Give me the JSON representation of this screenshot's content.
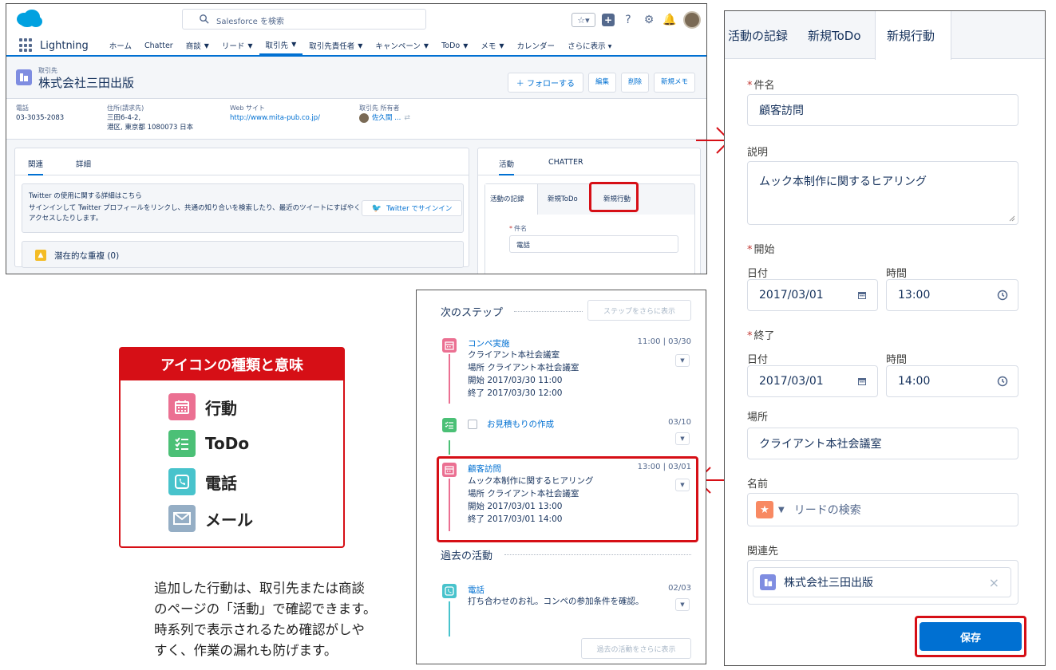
{
  "salesforce": {
    "search_placeholder": "Salesforce を検索",
    "app_name": "Lightning",
    "nav": [
      {
        "label": "ホーム",
        "chevron": false
      },
      {
        "label": "Chatter",
        "chevron": false
      },
      {
        "label": "商談",
        "chevron": true
      },
      {
        "label": "リード",
        "chevron": true
      },
      {
        "label": "取引先",
        "chevron": true
      },
      {
        "label": "取引先責任者",
        "chevron": true
      },
      {
        "label": "キャンペーン",
        "chevron": true
      },
      {
        "label": "ToDo",
        "chevron": true
      },
      {
        "label": "メモ",
        "chevron": true
      },
      {
        "label": "カレンダー",
        "chevron": false
      },
      {
        "label": "さらに表示 ▾",
        "chevron": false
      }
    ],
    "record": {
      "type_label": "取引先",
      "name": "株式会社三田出版",
      "buttons": {
        "follow": "＋ フォローする",
        "edit": "編集",
        "delete": "削除",
        "new_note": "新規メモ"
      }
    },
    "fields": {
      "phone_label": "電話",
      "phone": "03-3035-2083",
      "address_label": "住所(請求先)",
      "address_line1": "三田6-4-2,",
      "address_line2": "港区, 東京都 1080073 日本",
      "web_label": "Web サイト",
      "web": "http://www.mita-pub.co.jp/",
      "owner_label": "取引先 所有者",
      "owner": "佐久間 ..."
    },
    "left_tabs": {
      "related": "関連",
      "details": "詳細"
    },
    "twitter": {
      "title": "Twitter の使用に関する詳細はこちら",
      "body": "サインインして Twitter プロフィールをリンクし、共通の知り合いを検索したり、最近のツイートにすばやくアクセスしたりします。",
      "button": "Twitter でサインイン"
    },
    "duplicates": "潜在的な重複 (0)",
    "right_tabs": {
      "activity": "活動",
      "chatter": "CHATTER"
    },
    "inner_tabs": {
      "log": "活動の記録",
      "new_todo": "新規ToDo",
      "new_event": "新規行動"
    },
    "mini_subject_label": "件名",
    "mini_subject_value": "電話"
  },
  "legend": {
    "title": "アイコンの種類と意味",
    "items": [
      {
        "label": "行動",
        "color": "#eb7092"
      },
      {
        "label": "ToDo",
        "color": "#4bc076"
      },
      {
        "label": "電話",
        "color": "#48c3cc"
      },
      {
        "label": "メール",
        "color": "#95aec5"
      }
    ]
  },
  "caption": {
    "line1": "追加した行動は、取引先または商談",
    "line2": "のページの「活動」で確認できます。",
    "line3": "時系列で表示されるため確認がしや",
    "line4": "すく、作業の漏れも防げます。"
  },
  "timeline": {
    "next_steps": "次のステップ",
    "more_steps": "ステップをさらに表示",
    "event1": {
      "title": "コンペ実施",
      "date": "11:00 | 03/30",
      "l1": "クライアント本社会議室",
      "l2": "場所 クライアント本社会議室",
      "l3": "開始 2017/03/30 11:00",
      "l4": "終了 2017/03/30 12:00"
    },
    "todo1": {
      "title": "お見積もりの作成",
      "date": "03/10"
    },
    "event2": {
      "title": "顧客訪問",
      "date": "13:00 | 03/01",
      "l1": "ムック本制作に関するヒアリング",
      "l2": "場所 クライアント本社会議室",
      "l3": "開始 2017/03/01 13:00",
      "l4": "終了 2017/03/01 14:00"
    },
    "past": "過去の活動",
    "call1": {
      "title": "電話",
      "date": "02/03",
      "l1": "打ち合わせのお礼。コンペの参加条件を確認。"
    },
    "more_past": "過去の活動をさらに表示"
  },
  "form": {
    "tabs": {
      "log": "活動の記録",
      "new_todo": "新規ToDo",
      "new_event": "新規行動"
    },
    "subject_label": "件名",
    "subject": "顧客訪問",
    "description_label": "説明",
    "description": "ムック本制作に関するヒアリング",
    "start_label": "開始",
    "end_label": "終了",
    "date_label": "日付",
    "time_label": "時間",
    "start_date": "2017/03/01",
    "start_time": "13:00",
    "end_date": "2017/03/01",
    "end_time": "14:00",
    "location_label": "場所",
    "location": "クライアント本社会議室",
    "name_label": "名前",
    "lead_search": "リードの検索",
    "related_label": "関連先",
    "related": "株式会社三田出版",
    "save": "保存"
  },
  "colors": {
    "accent": "#0070d2",
    "highlight": "#d60f16"
  }
}
